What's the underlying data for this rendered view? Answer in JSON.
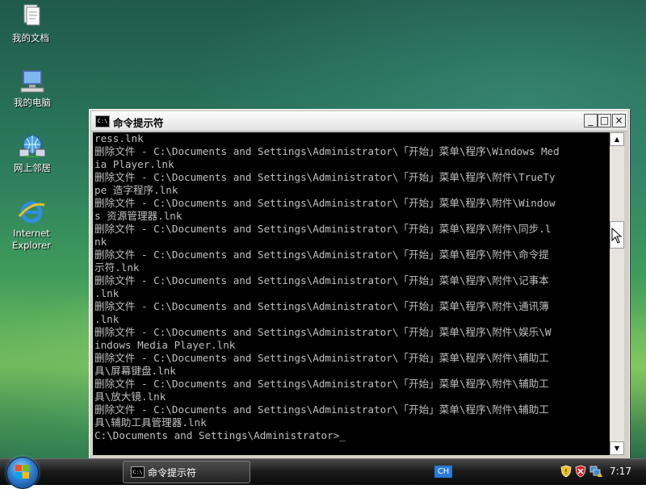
{
  "desktop": {
    "icons": [
      {
        "label": "我的文档",
        "icon": "my-documents-icon"
      },
      {
        "label": "我的电脑",
        "icon": "my-computer-icon"
      },
      {
        "label": "网上邻居",
        "icon": "network-places-icon"
      },
      {
        "label": "Internet Explorer",
        "icon": "internet-explorer-icon"
      }
    ]
  },
  "window": {
    "title": "命令提示符",
    "icon_text": "C:\\",
    "buttons": {
      "minimize": "_",
      "maximize": "□",
      "close": "×"
    },
    "scroll_position": 0.28,
    "console_text": "ress.lnk\n删除文件 - C:\\Documents and Settings\\Administrator\\「开始」菜单\\程序\\Windows Med\nia Player.lnk\n删除文件 - C:\\Documents and Settings\\Administrator\\「开始」菜单\\程序\\附件\\TrueTy\npe 造字程序.lnk\n删除文件 - C:\\Documents and Settings\\Administrator\\「开始」菜单\\程序\\附件\\Window\ns 资源管理器.lnk\n删除文件 - C:\\Documents and Settings\\Administrator\\「开始」菜单\\程序\\附件\\同步.l\nnk\n删除文件 - C:\\Documents and Settings\\Administrator\\「开始」菜单\\程序\\附件\\命令提\n示符.lnk\n删除文件 - C:\\Documents and Settings\\Administrator\\「开始」菜单\\程序\\附件\\记事本\n.lnk\n删除文件 - C:\\Documents and Settings\\Administrator\\「开始」菜单\\程序\\附件\\通讯簿\n.lnk\n删除文件 - C:\\Documents and Settings\\Administrator\\「开始」菜单\\程序\\附件\\娱乐\\W\nindows Media Player.lnk\n删除文件 - C:\\Documents and Settings\\Administrator\\「开始」菜单\\程序\\附件\\辅助工\n具\\屏幕键盘.lnk\n删除文件 - C:\\Documents and Settings\\Administrator\\「开始」菜单\\程序\\附件\\辅助工\n具\\放大镜.lnk\n删除文件 - C:\\Documents and Settings\\Administrator\\「开始」菜单\\程序\\附件\\辅助工\n具\\辅助工具管理器.lnk\n",
    "prompt": "C:\\Documents and Settings\\Administrator>"
  },
  "taskbar": {
    "start_icon": "windows-start-orb",
    "task_label": "命令提示符",
    "task_icon_text": "C:\\",
    "language": "CH",
    "clock": "7:17",
    "tray_icons": [
      "security-shield-icon",
      "security-alert-icon",
      "network-warning-icon"
    ]
  },
  "colors": {
    "console_bg": "#000000",
    "console_text": "#c0c0c0",
    "taskbar": "#1c1c1c",
    "language_badge": "#2a7ad8"
  }
}
